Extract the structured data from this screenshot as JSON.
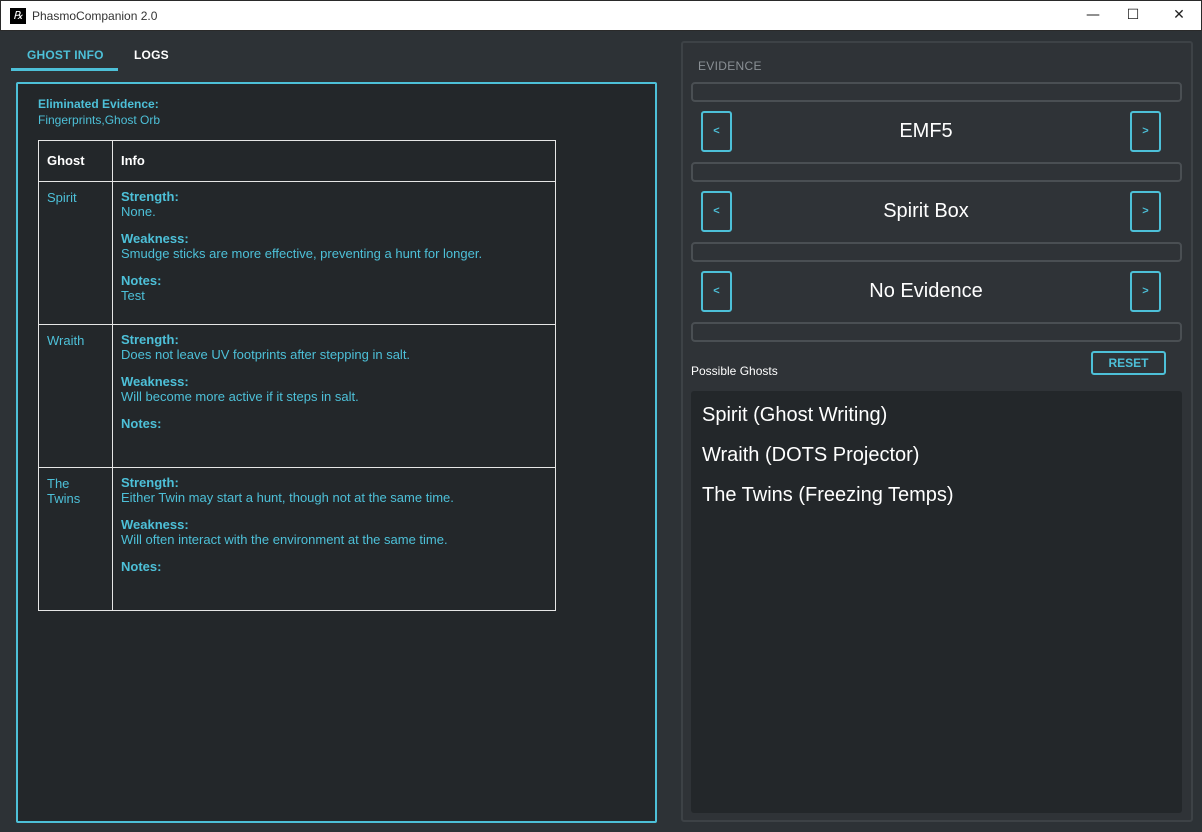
{
  "window": {
    "title": "PhasmoCompanion 2.0",
    "icon_glyph": "℞",
    "minimize": "—",
    "maximize": "☐",
    "close": "✕"
  },
  "tabs": {
    "ghost_info": "GHOST INFO",
    "logs": "LOGS",
    "active": "GHOST INFO"
  },
  "ghost_info": {
    "eliminated_label": "Eliminated Evidence:",
    "eliminated_value": "Fingerprints,Ghost Orb",
    "table": {
      "headers": [
        "Ghost",
        "Info"
      ],
      "strength_label": "Strength:",
      "weakness_label": "Weakness:",
      "notes_label": "Notes:",
      "rows": [
        {
          "ghost": "Spirit",
          "strength": "None.",
          "weakness": "Smudge sticks are more effective, preventing a hunt for longer.",
          "notes": "Test"
        },
        {
          "ghost": "Wraith",
          "strength": "Does not leave UV footprints after stepping in salt.",
          "weakness": "Will become more active if it steps in salt.",
          "notes": ""
        },
        {
          "ghost": "The Twins",
          "strength": "Either Twin may start a hunt, though not at the same time.",
          "weakness": "Will often interact with the environment at the same time.",
          "notes": ""
        }
      ]
    }
  },
  "evidence": {
    "title": "EVIDENCE",
    "prev_label": "<",
    "next_label": ">",
    "slots": [
      "EMF5",
      "Spirit Box",
      "No Evidence"
    ]
  },
  "possible_ghosts": {
    "label": "Possible Ghosts",
    "reset_label": "RESET",
    "items": [
      "Spirit (Ghost Writing)",
      "Wraith (DOTS Projector)",
      "The Twins (Freezing Temps)"
    ]
  },
  "colors": {
    "accent": "#4dc0d8",
    "background": "#2d3236",
    "panel": "#23272a"
  }
}
